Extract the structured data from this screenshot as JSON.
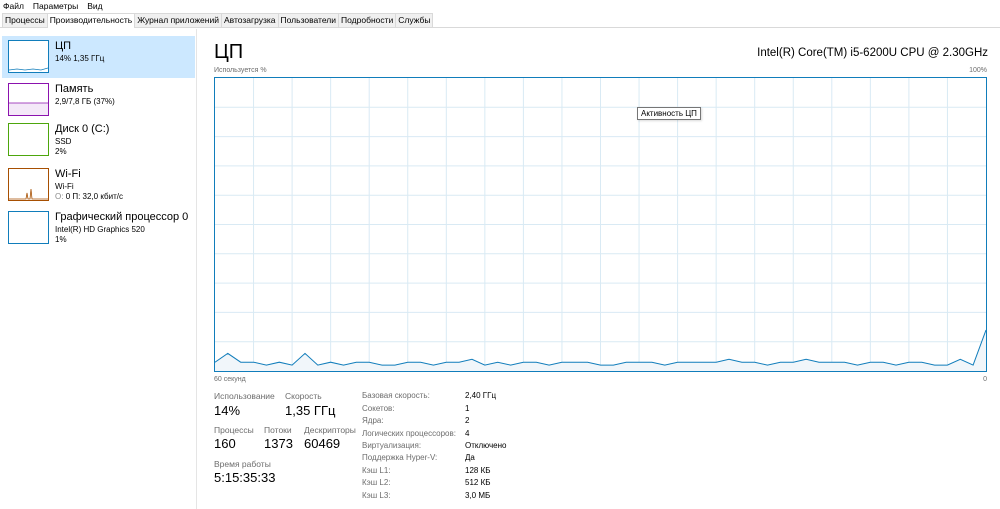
{
  "menu": [
    "Файл",
    "Параметры",
    "Вид"
  ],
  "tabs": [
    "Процессы",
    "Производительность",
    "Журнал приложений",
    "Автозагрузка",
    "Пользователи",
    "Подробности",
    "Службы"
  ],
  "active_tab": "Производительность",
  "sidebar": {
    "items": [
      {
        "title": "ЦП",
        "line1": "14% 1,35 ГГц",
        "line2": "",
        "color": "#117dbb",
        "selected": true
      },
      {
        "title": "Память",
        "line1": "2,9/7,8 ГБ (37%)",
        "line2": "",
        "color": "#8b12ae",
        "selected": false
      },
      {
        "title": "Диск 0 (C:)",
        "line1": "SSD",
        "line2": "2%",
        "color": "#4da60c",
        "selected": false
      },
      {
        "title": "Wi-Fi",
        "line1": "Wi-Fi",
        "line2_prefix": "О:",
        "line2": "0 П: 32,0 кбит/с",
        "color": "#a74f01",
        "selected": false
      },
      {
        "title": "Графический процессор 0",
        "line1": "Intel(R) HD Graphics 520",
        "line2": "1%",
        "color": "#117dbb",
        "selected": false
      }
    ]
  },
  "main": {
    "title": "ЦП",
    "cpu_name": "Intel(R) Core(TM) i5-6200U CPU @ 2.30GHz",
    "graph_top_left": "Используется %",
    "graph_top_right": "100%",
    "graph_bottom_left": "60 секунд",
    "graph_bottom_right": "0",
    "tooltip": "Активность ЦП",
    "graph_color": "#117dbb",
    "stats": {
      "usage_label": "Использование",
      "usage_value": "14%",
      "speed_label": "Скорость",
      "speed_value": "1,35 ГГц",
      "processes_label": "Процессы",
      "processes_value": "160",
      "threads_label": "Потоки",
      "threads_value": "1373",
      "handles_label": "Дескрипторы",
      "handles_value": "60469",
      "uptime_label": "Время работы",
      "uptime_value": "5:15:35:33"
    },
    "details": [
      {
        "key": "Базовая скорость:",
        "value": "2,40 ГГц"
      },
      {
        "key": "Сокетов:",
        "value": "1"
      },
      {
        "key": "Ядра:",
        "value": "2"
      },
      {
        "key": "Логических процессоров:",
        "value": "4"
      },
      {
        "key": "Виртуализация:",
        "value": "Отключено"
      },
      {
        "key": "Поддержка Hyper-V:",
        "value": "Да"
      },
      {
        "key": "Кэш L1:",
        "value": "128 КБ"
      },
      {
        "key": "Кэш L2:",
        "value": "512 КБ"
      },
      {
        "key": "Кэш L3:",
        "value": "3,0 МБ"
      }
    ]
  },
  "chart_data": {
    "type": "area",
    "title": "",
    "xlabel": "",
    "ylabel": "Используется %",
    "xlim": [
      60,
      0
    ],
    "ylim": [
      0,
      100
    ],
    "x": [
      60,
      59,
      58,
      57,
      56,
      55,
      54,
      53,
      52,
      51,
      50,
      49,
      48,
      47,
      46,
      45,
      44,
      43,
      42,
      41,
      40,
      39,
      38,
      37,
      36,
      35,
      34,
      33,
      32,
      31,
      30,
      29,
      28,
      27,
      26,
      25,
      24,
      23,
      22,
      21,
      20,
      19,
      18,
      17,
      16,
      15,
      14,
      13,
      12,
      11,
      10,
      9,
      8,
      7,
      6,
      5,
      4,
      3,
      2,
      1,
      0
    ],
    "series": [
      {
        "values": [
          3,
          6,
          3,
          3,
          2,
          3,
          2,
          6,
          2,
          3,
          2,
          3,
          3,
          2,
          2,
          3,
          3,
          2,
          3,
          3,
          4,
          2,
          3,
          2,
          3,
          3,
          2,
          3,
          3,
          3,
          2,
          2,
          3,
          3,
          3,
          2,
          3,
          3,
          3,
          3,
          4,
          3,
          3,
          2,
          3,
          3,
          4,
          3,
          3,
          3,
          2,
          3,
          3,
          2,
          3,
          3,
          2,
          2,
          4,
          2,
          14
        ]
      }
    ]
  }
}
